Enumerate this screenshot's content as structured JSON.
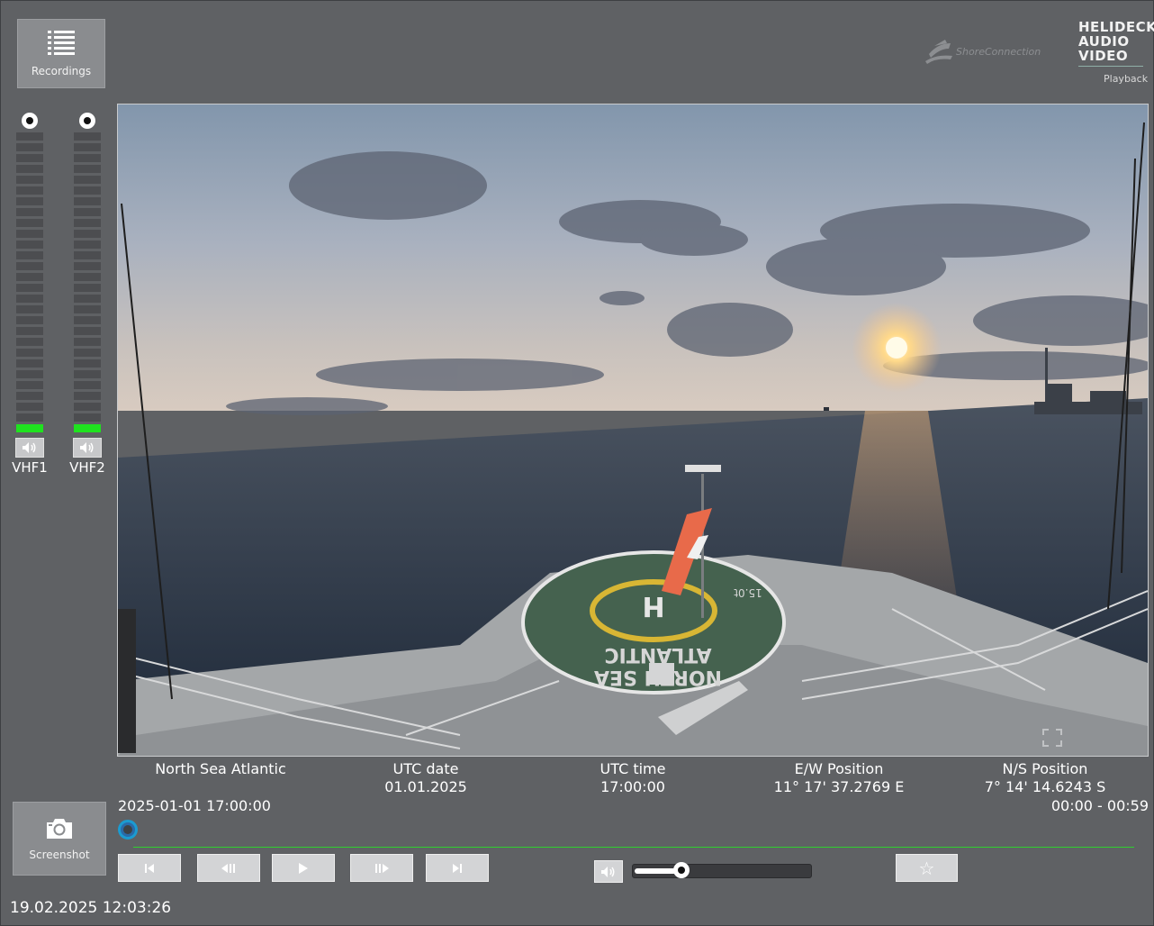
{
  "header": {
    "recordings_label": "Recordings",
    "shore_logo_text": "ShoreConnection",
    "product_lines": [
      "HELIDECK",
      "AUDIO",
      "VIDEO"
    ],
    "product_mode": "Playback"
  },
  "meters": [
    {
      "label": "VHF1",
      "level": 0.05
    },
    {
      "label": "VHF2",
      "level": 0.05
    }
  ],
  "video": {
    "deck_text_top": "NORTH SEA",
    "deck_text_bottom": "ATLANTIC",
    "helipad_letter": "H",
    "deck_marking": "15.0t"
  },
  "info": {
    "vessel": "North Sea Atlantic",
    "utc_date_label": "UTC date",
    "utc_date_value": "01.01.2025",
    "utc_time_label": "UTC time",
    "utc_time_value": "17:00:00",
    "ew_label": "E/W Position",
    "ew_value": "11° 17' 37.2769 E",
    "ns_label": "N/S Position",
    "ns_value": "7° 14' 14.6243 S"
  },
  "timeline": {
    "start_timestamp": "2025-01-01 17:00:00",
    "range": "00:00 - 00:59",
    "position": 0.0
  },
  "controls": {
    "screenshot_label": "Screenshot",
    "volume": 0.25,
    "favorite_symbol": "☆"
  },
  "footer": {
    "clock": "19.02.2025 12:03:26"
  },
  "colors": {
    "background": "#5f6164",
    "meter_on": "#1fe21f",
    "timeline": "#2fcf2f",
    "button": "#d3d4d6"
  }
}
